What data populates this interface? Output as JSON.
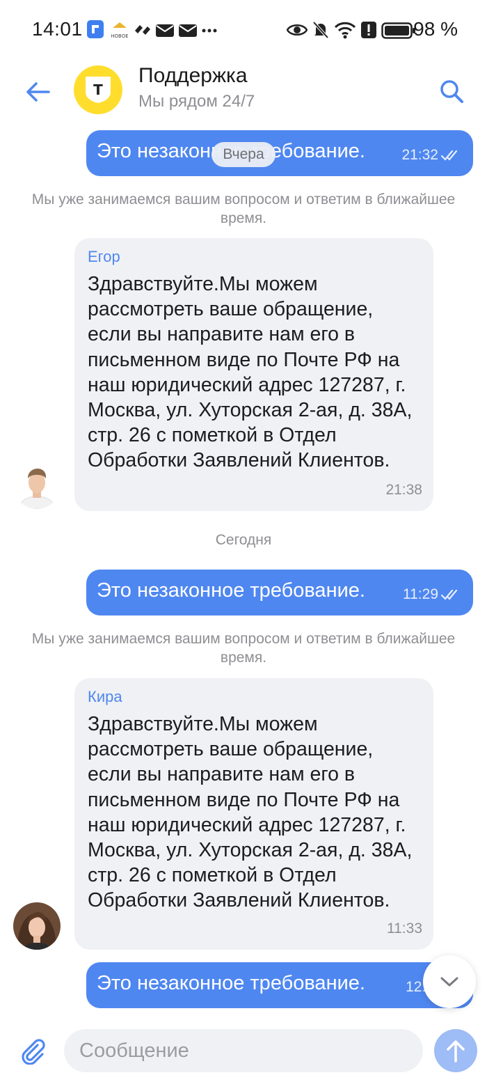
{
  "status_bar": {
    "time": "14:01",
    "battery_percent": "98 %"
  },
  "header": {
    "title": "Поддержка",
    "subtitle": "Мы рядом 24/7",
    "logo_letter": "Т"
  },
  "chat": {
    "date_pill": "Вчера",
    "messages": [
      {
        "direction": "out",
        "text": "Это незаконное требование.",
        "time": "21:32",
        "status": "read"
      },
      {
        "direction": "system",
        "text": "Мы уже занимаемся вашим вопросом и ответим в ближайшее время."
      },
      {
        "direction": "in",
        "author": "Егор",
        "text": "Здравствуйте.Мы можем рассмотреть ваше обращение, если вы направите нам его в письменном виде по Почте РФ на наш юридический адрес 127287, г. Москва, ул. Хуторская 2-ая, д. 38А, стр. 26 с пометкой в Отдел Обработки Заявлений Клиентов.",
        "time": "21:38"
      },
      {
        "direction": "date",
        "text": "Сегодня"
      },
      {
        "direction": "out",
        "text": "Это незаконное требование.",
        "time": "11:29",
        "status": "read"
      },
      {
        "direction": "system",
        "text": "Мы уже занимаемся вашим вопросом и ответим в ближайшее время."
      },
      {
        "direction": "in",
        "author": "Кира",
        "text": "Здравствуйте.Мы можем рассмотреть ваше обращение, если вы направите нам его в письменном виде по Почте РФ на наш юридический адрес 127287, г. Москва, ул. Хуторская 2-ая, д. 38А, стр. 26 с пометкой в Отдел Обработки Заявлений Клиентов.",
        "time": "11:33"
      },
      {
        "direction": "out",
        "text": "Это незаконное требование.",
        "time": "12:3"
      }
    ]
  },
  "composer": {
    "placeholder": "Сообщение"
  },
  "colors": {
    "accent": "#4f87f0",
    "brand_yellow": "#ffdd2d",
    "incoming_bg": "#f0f1f4"
  },
  "icons": [
    "back-arrow-icon",
    "search-icon",
    "double-check-icon",
    "chevron-down-icon",
    "paperclip-icon",
    "send-arrow-icon"
  ]
}
